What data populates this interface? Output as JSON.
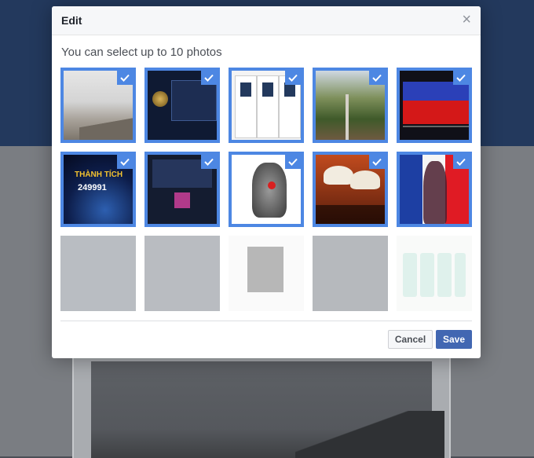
{
  "dialog": {
    "title": "Edit",
    "close_glyph": "×",
    "instruction": "You can select up to 10 photos"
  },
  "photos": [
    {
      "selected": true,
      "enabled": true
    },
    {
      "selected": true,
      "enabled": true
    },
    {
      "selected": true,
      "enabled": true
    },
    {
      "selected": true,
      "enabled": true
    },
    {
      "selected": true,
      "enabled": true
    },
    {
      "selected": true,
      "enabled": true
    },
    {
      "selected": true,
      "enabled": true
    },
    {
      "selected": true,
      "enabled": true
    },
    {
      "selected": true,
      "enabled": true
    },
    {
      "selected": true,
      "enabled": true
    },
    {
      "selected": false,
      "enabled": false
    },
    {
      "selected": false,
      "enabled": false
    },
    {
      "selected": false,
      "enabled": false
    },
    {
      "selected": false,
      "enabled": false
    },
    {
      "selected": false,
      "enabled": false
    }
  ],
  "photo_text": {
    "thanh_tich": "THÀNH TÍCH",
    "score": "249991"
  },
  "buttons": {
    "cancel": "Cancel",
    "save": "Save"
  },
  "colors": {
    "accent": "#4d87e3",
    "save_button": "#4267b2",
    "header_bg": "#23395d"
  },
  "icons": {
    "check": "checkmark-icon",
    "close": "close-icon"
  }
}
